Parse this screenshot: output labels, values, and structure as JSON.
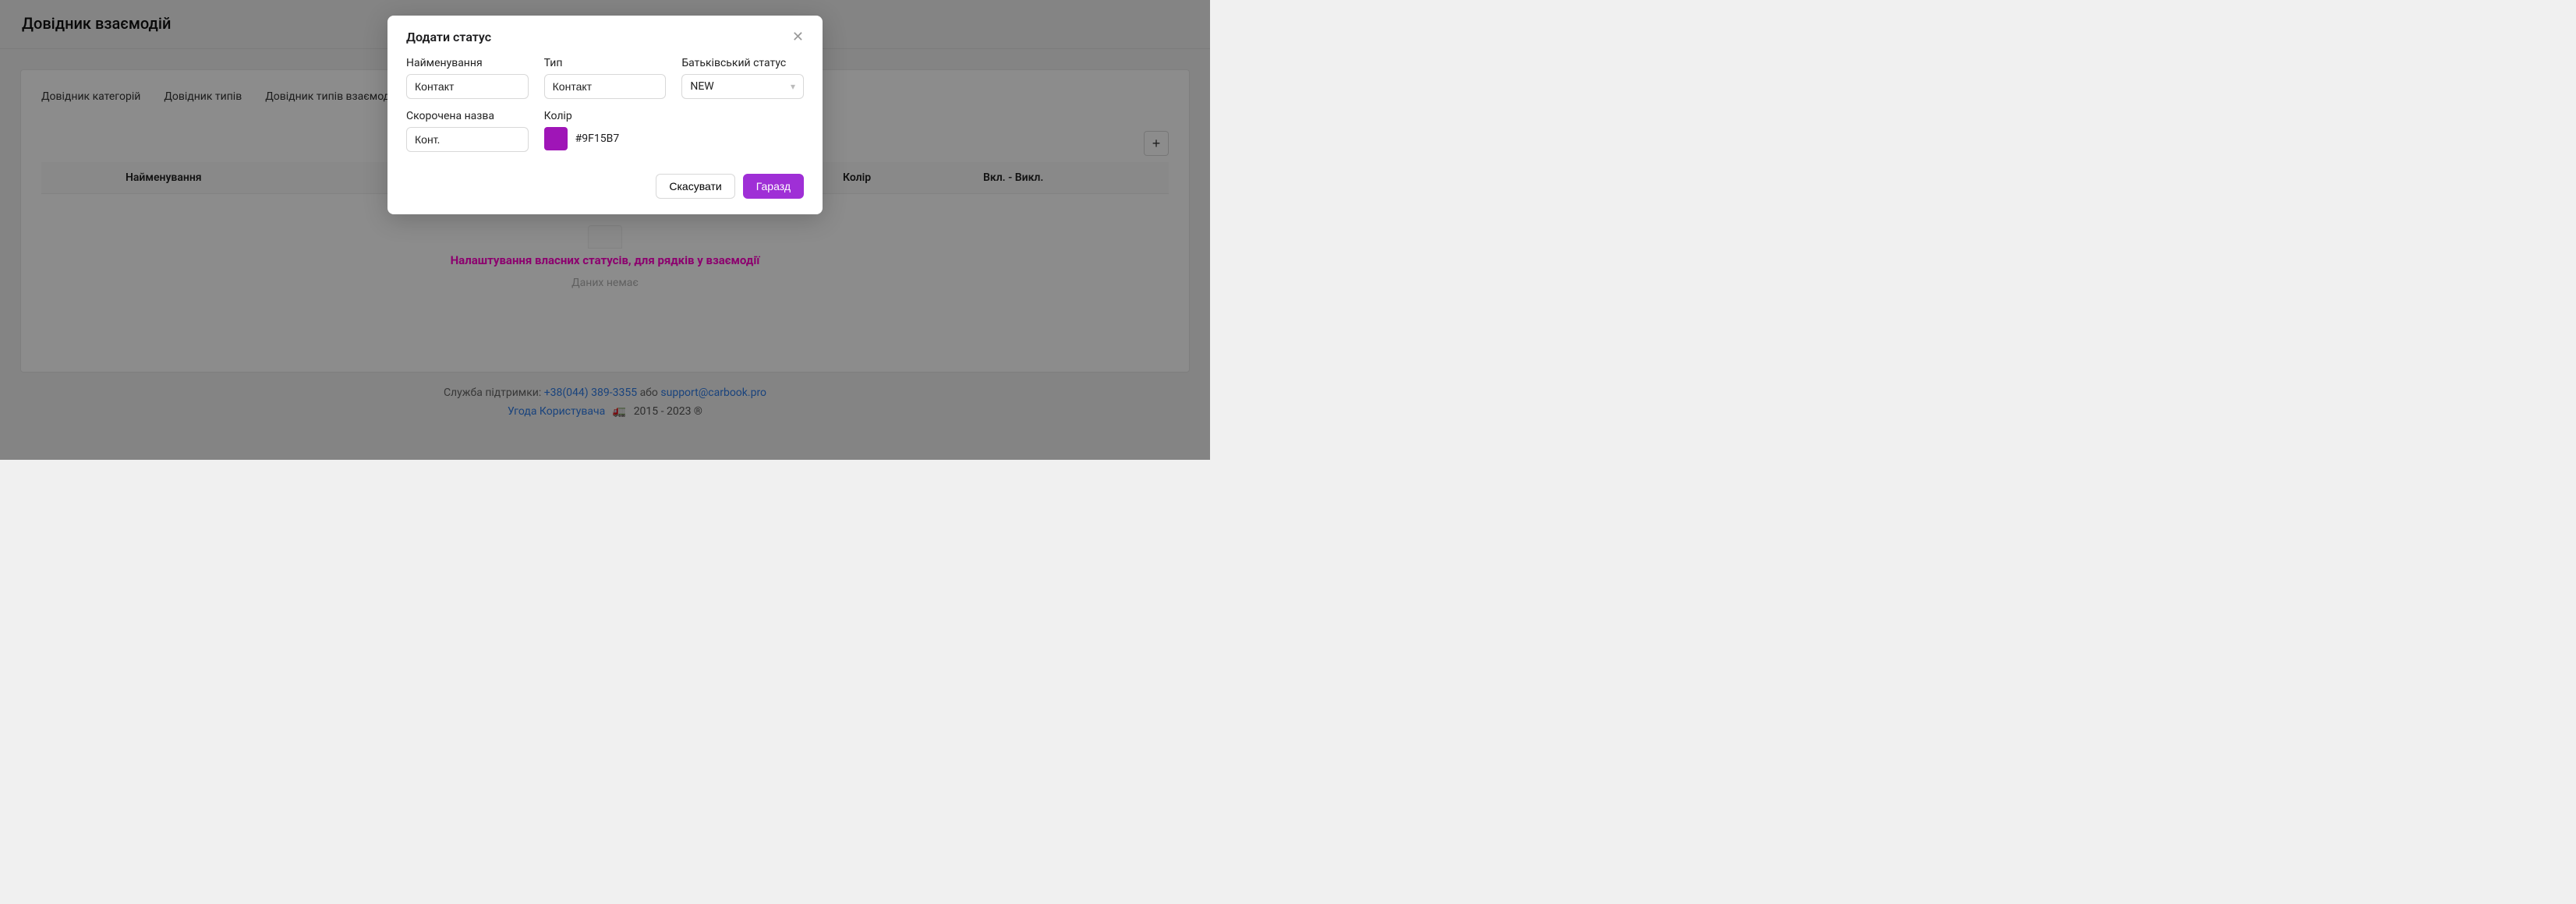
{
  "header": {
    "title": "Довідник взаємодій"
  },
  "tabs": [
    "Довідник категорій",
    "Довідник типів",
    "Довідник типів взаємодії"
  ],
  "toolbar": {
    "add_glyph": "+"
  },
  "table": {
    "columns": {
      "name": "Найменування",
      "color": "Колір",
      "toggle": "Вкл. - Викл."
    },
    "annotation": "Налаштування власних статусів, для рядків у взаємодії",
    "empty_text": "Даних немає"
  },
  "footer": {
    "support_prefix": "Служба підтримки: ",
    "phone": "+38(044) 389-3355",
    "or": " або ",
    "email": "support@carbook.pro",
    "agreement": "Угода Користувача",
    "truck_glyph": "🚛",
    "years": "2015 - 2023 ®"
  },
  "modal": {
    "title": "Додати статус",
    "fields": {
      "name": {
        "label": "Найменування",
        "value": "Контакт"
      },
      "type": {
        "label": "Тип",
        "value": "Контакт"
      },
      "parent": {
        "label": "Батьківський статус",
        "value": "NEW"
      },
      "short": {
        "label": "Скорочена назва",
        "value": "Конт."
      },
      "color": {
        "label": "Колір",
        "value": "#9F15B7"
      }
    },
    "buttons": {
      "cancel": "Скасувати",
      "ok": "Гаразд"
    },
    "close_glyph": "✕"
  }
}
